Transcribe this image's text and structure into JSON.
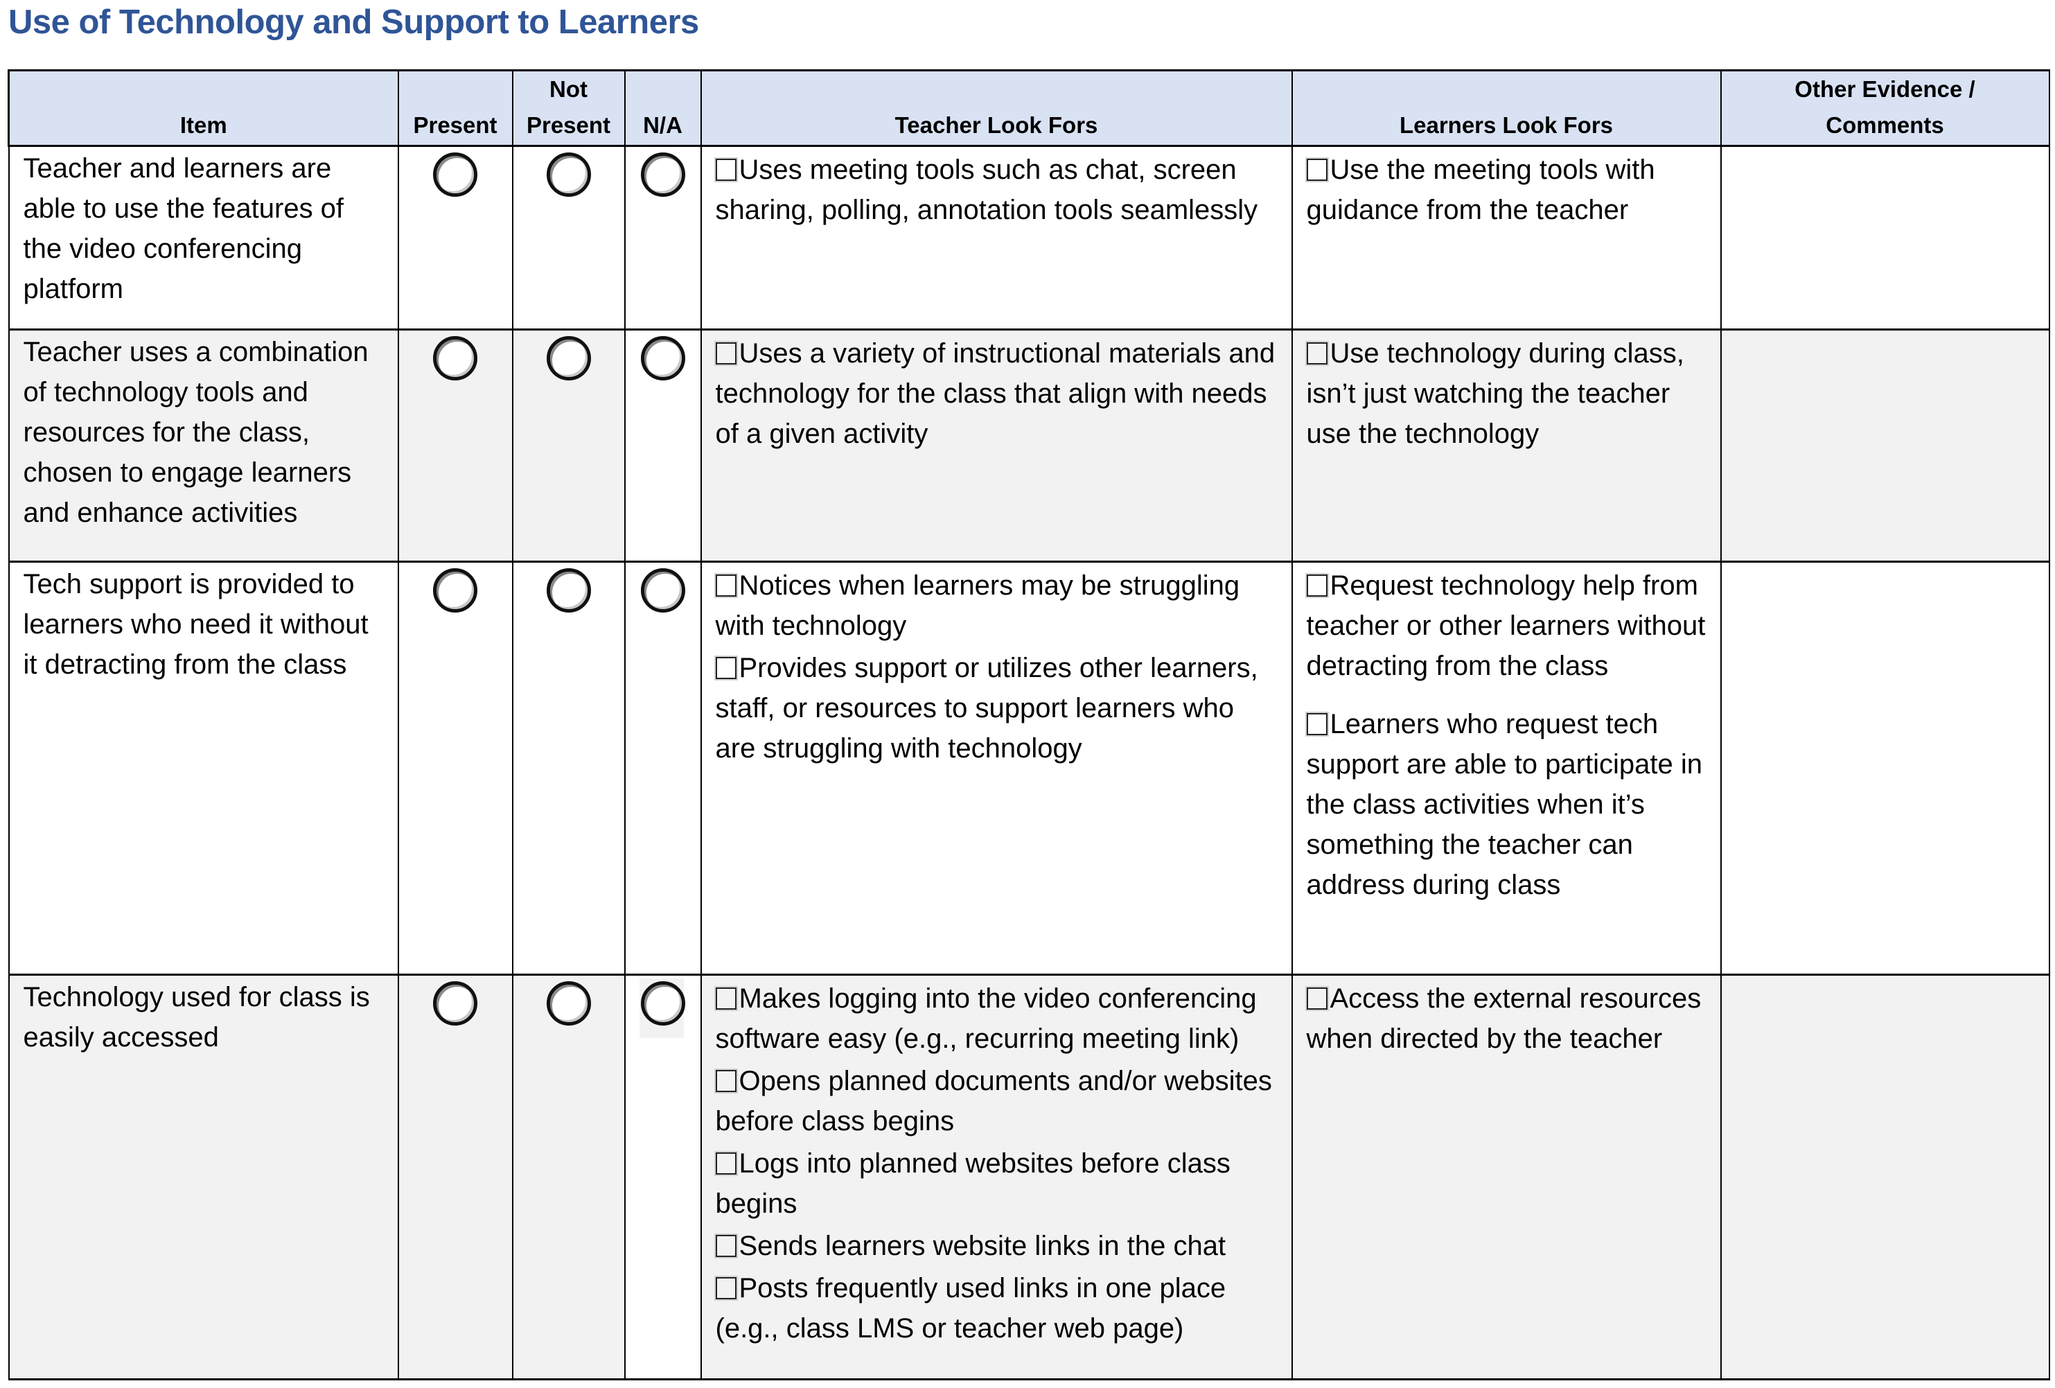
{
  "title": "Use of Technology and Support to Learners",
  "colors": {
    "title": "#2F5597",
    "header_bg": "#D9E2F3",
    "shaded_row_bg": "#F2F2F2"
  },
  "table": {
    "headers": {
      "item": "Item",
      "present": "Present",
      "not_present_line1": "Not",
      "not_present_line2": "Present",
      "na": "N/A",
      "teacher": "Teacher Look Fors",
      "learners": "Learners Look Fors",
      "comments_line1": "Other Evidence /",
      "comments_line2": "Comments"
    },
    "rows": [
      {
        "item": "Teacher and learners are able to use the features of the video conferencing platform",
        "present": false,
        "not_present": false,
        "na": false,
        "teacher_look_fors": [
          "Uses meeting tools such as chat, screen sharing, polling, annotation tools seamlessly"
        ],
        "learners_look_fors": [
          "Use the meeting tools with guidance from the teacher"
        ],
        "comments": ""
      },
      {
        "item": "Teacher uses a combination of technology tools and resources for the class, chosen to engage learners and enhance activities",
        "present": false,
        "not_present": false,
        "na": false,
        "teacher_look_fors": [
          "Uses a variety of instructional materials and technology for the class that align with needs of a given activity"
        ],
        "learners_look_fors": [
          "Use technology during class, isn’t just watching the teacher use the technology"
        ],
        "comments": ""
      },
      {
        "item": "Tech support is provided to learners who need it without it detracting from the class",
        "present": false,
        "not_present": false,
        "na": false,
        "teacher_look_fors": [
          "Notices when learners may be struggling with technology",
          "Provides support or utilizes other learners, staff, or resources to support learners who are struggling with technology"
        ],
        "learners_look_fors": [
          "Request technology help from teacher or other learners without detracting from the class",
          "Learners who request tech support are able to participate in the class activities when it’s something the teacher can address during class"
        ],
        "comments": ""
      },
      {
        "item": "Technology used for class is easily accessed",
        "present": false,
        "not_present": false,
        "na": false,
        "teacher_look_fors": [
          "Makes logging into the video conferencing software easy (e.g., recurring meeting link)",
          "Opens planned documents and/or websites before class begins",
          "Logs into planned websites before class begins",
          "Sends learners website links in the chat",
          "Posts frequently used links in one place (e.g., class LMS or teacher web page)"
        ],
        "learners_look_fors": [
          "Access the external resources when directed by the teacher"
        ],
        "comments": ""
      }
    ]
  }
}
